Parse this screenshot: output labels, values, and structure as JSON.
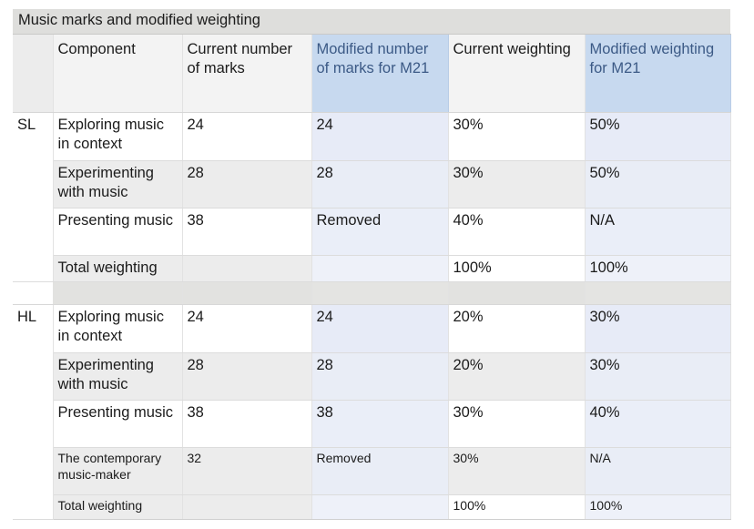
{
  "title": "Music marks and modified weighting",
  "colors": {
    "header_blue": "#c7d9ef",
    "header_blue_text": "#3c5a86",
    "body_blue": "#e7ebf7",
    "body_blue_text": "#55698f",
    "title_bar": "#dededc",
    "stripe_gray": "#ececec"
  },
  "columns": [
    {
      "key": "tag",
      "label": ""
    },
    {
      "key": "component",
      "label": "Component"
    },
    {
      "key": "current_marks",
      "label": "Current number of marks"
    },
    {
      "key": "modified_marks",
      "label": "Modified number of marks for M21"
    },
    {
      "key": "current_weight",
      "label": "Current weighting"
    },
    {
      "key": "modified_weight",
      "label": "Modified weighting for M21"
    }
  ],
  "sections": [
    {
      "tag": "SL",
      "rows": [
        {
          "component": "Exploring music in context",
          "current_marks": "24",
          "modified_marks": "24",
          "current_weight": "30%",
          "modified_weight": "50%"
        },
        {
          "component": "Experimenting with music",
          "current_marks": "28",
          "modified_marks": "28",
          "current_weight": "30%",
          "modified_weight": "50%"
        },
        {
          "component": "Presenting music",
          "current_marks": "38",
          "modified_marks": "Removed",
          "current_weight": "40%",
          "modified_weight": "N/A"
        }
      ],
      "total": {
        "component": "Total weighting",
        "current_marks": "",
        "modified_marks": "",
        "current_weight": "100%",
        "modified_weight": "100%"
      }
    },
    {
      "tag": "HL",
      "rows": [
        {
          "component": "Exploring music in context",
          "current_marks": "24",
          "modified_marks": "24",
          "current_weight": "20%",
          "modified_weight": "30%"
        },
        {
          "component": "Experimenting with music",
          "current_marks": "28",
          "modified_marks": "28",
          "current_weight": "20%",
          "modified_weight": "30%"
        },
        {
          "component": "Presenting music",
          "current_marks": "38",
          "modified_marks": "38",
          "current_weight": "30%",
          "modified_weight": "40%"
        },
        {
          "component": "The contemporary music-maker",
          "current_marks": "32",
          "modified_marks": "Removed",
          "current_weight": "30%",
          "modified_weight": "N/A"
        }
      ],
      "total": {
        "component": "Total weighting",
        "current_marks": "",
        "modified_marks": "",
        "current_weight": "100%",
        "modified_weight": "100%"
      }
    }
  ]
}
